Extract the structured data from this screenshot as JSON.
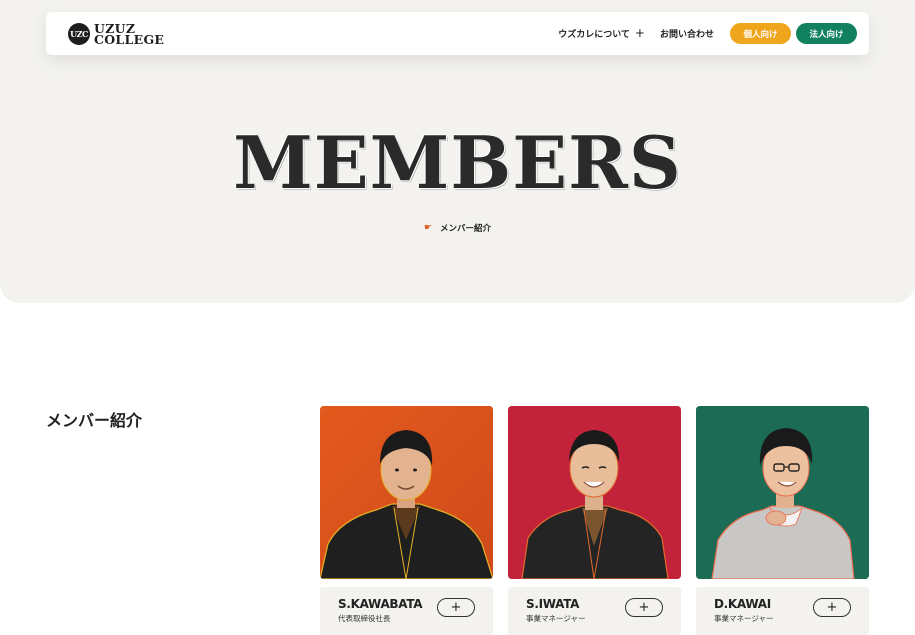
{
  "header": {
    "logo_mark": "UZC",
    "logo_line1": "UZUZ",
    "logo_line2": "COLLEGE",
    "nav_about": "ウズカレについて",
    "nav_about_icon": "plus-icon",
    "nav_contact": "お問い合わせ",
    "btn_individual": "個人向け",
    "btn_corporate": "法人向け"
  },
  "hero": {
    "title": "MEMBERS",
    "breadcrumb_icon": "pointing-hand-icon",
    "breadcrumb": "メンバー紹介"
  },
  "section": {
    "title": "メンバー紹介"
  },
  "members": [
    {
      "name": "S.KAWABATA",
      "role": "代表取締役社長",
      "bg": "#e0541f",
      "toggle": "+"
    },
    {
      "name": "S.IWATA",
      "role": "事業マネージャー",
      "bg": "#c3233a",
      "toggle": "+"
    },
    {
      "name": "D.KAWAI",
      "role": "事業マネージャー",
      "bg": "#1b6b55",
      "toggle": "+"
    }
  ],
  "colors": {
    "hero_bg": "#f3f2ee",
    "individual": "#efa51c",
    "corporate": "#12815f"
  }
}
